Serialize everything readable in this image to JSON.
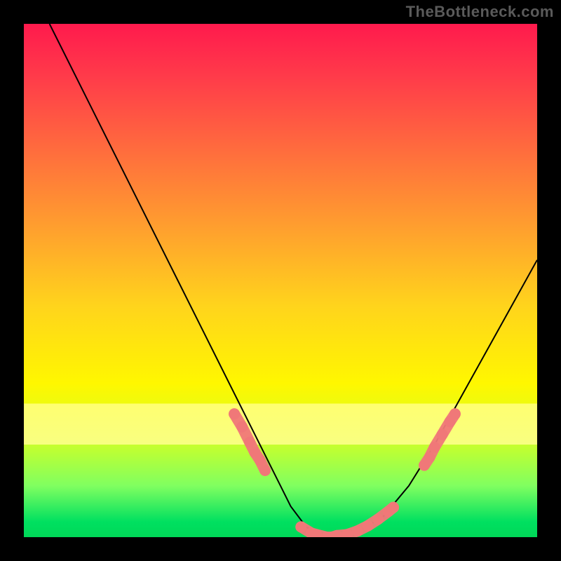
{
  "watermark": "TheBottleneck.com",
  "chart_data": {
    "type": "line",
    "title": "",
    "xlabel": "",
    "ylabel": "",
    "xlim": [
      0,
      100
    ],
    "ylim": [
      0,
      100
    ],
    "grid": false,
    "legend": false,
    "gradient_stops": [
      {
        "pos": 0,
        "color": "#ff1a4d"
      },
      {
        "pos": 24,
        "color": "#ff6a3e"
      },
      {
        "pos": 55,
        "color": "#ffd41c"
      },
      {
        "pos": 74,
        "color": "#ffff70"
      },
      {
        "pos": 90,
        "color": "#80ff60"
      },
      {
        "pos": 100,
        "color": "#00d858"
      }
    ],
    "series": [
      {
        "name": "bottleneck-curve",
        "x": [
          5,
          10,
          15,
          20,
          25,
          30,
          35,
          40,
          45,
          50,
          52,
          55,
          58,
          60,
          65,
          70,
          75,
          80,
          85,
          90,
          95,
          100
        ],
        "y": [
          100,
          90,
          80,
          70,
          60,
          50,
          40,
          30,
          20,
          10,
          6,
          2,
          0,
          0,
          1,
          4,
          10,
          18,
          27,
          36,
          45,
          54
        ]
      }
    ],
    "markers": [
      {
        "name": "left-cluster",
        "x": [
          41,
          42.5,
          44,
          45,
          46,
          47
        ],
        "y": [
          24,
          21.5,
          18.5,
          16.5,
          15,
          13
        ]
      },
      {
        "name": "bottom-cluster",
        "x": [
          54,
          56,
          57,
          59,
          60,
          61,
          63,
          65,
          67,
          69,
          71,
          72
        ],
        "y": [
          2,
          0.8,
          0.5,
          0,
          0,
          0.3,
          0.5,
          1.2,
          2.2,
          3.5,
          5,
          5.8
        ]
      },
      {
        "name": "right-cluster",
        "x": [
          78,
          79,
          80,
          81.5,
          83,
          84
        ],
        "y": [
          14,
          15.5,
          17.5,
          20,
          22.5,
          24
        ]
      }
    ],
    "marker_color": "#f07878",
    "curve_color": "#000000"
  }
}
